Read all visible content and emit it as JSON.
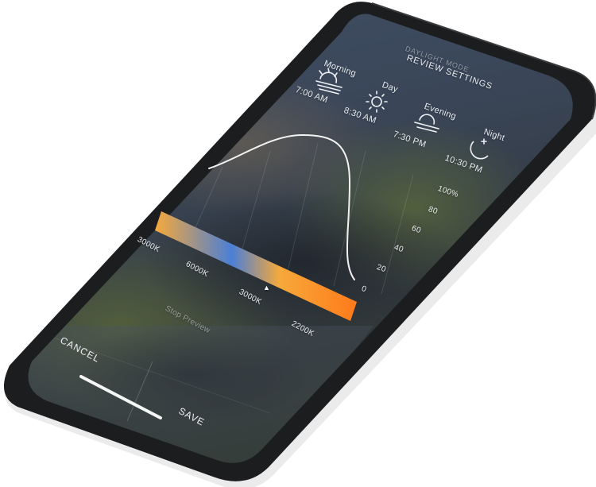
{
  "header": {
    "mode_label": "DAYLIGHT MODE",
    "title": "REVIEW SETTINGS"
  },
  "schedule": [
    {
      "name": "Morning",
      "time": "7:00 AM",
      "icon": "sunrise-icon"
    },
    {
      "name": "Day",
      "time": "8:30 AM",
      "icon": "sun-icon"
    },
    {
      "name": "Evening",
      "time": "7:30 PM",
      "icon": "sunset-icon"
    },
    {
      "name": "Night",
      "time": "10:30 PM",
      "icon": "moon-stars-icon"
    }
  ],
  "brightness_axis": [
    "100%",
    "80",
    "60",
    "40",
    "20",
    "0"
  ],
  "color_temperature": {
    "labels": [
      "3000K",
      "6000K",
      "3000K",
      "2200K"
    ],
    "gradient": [
      "#f6a93a",
      "#4b7fd6",
      "#f6a93a",
      "#ff7a1a"
    ],
    "marker_symbol": "▲"
  },
  "actions": {
    "stop_preview": "Stop Preview",
    "cancel": "CANCEL",
    "save": "SAVE"
  },
  "colors": {
    "phone_body": "#1b1c1e",
    "screen_top": "#3e4b5e",
    "screen_bottom": "#27303c",
    "curve": "#f2f2f2"
  }
}
